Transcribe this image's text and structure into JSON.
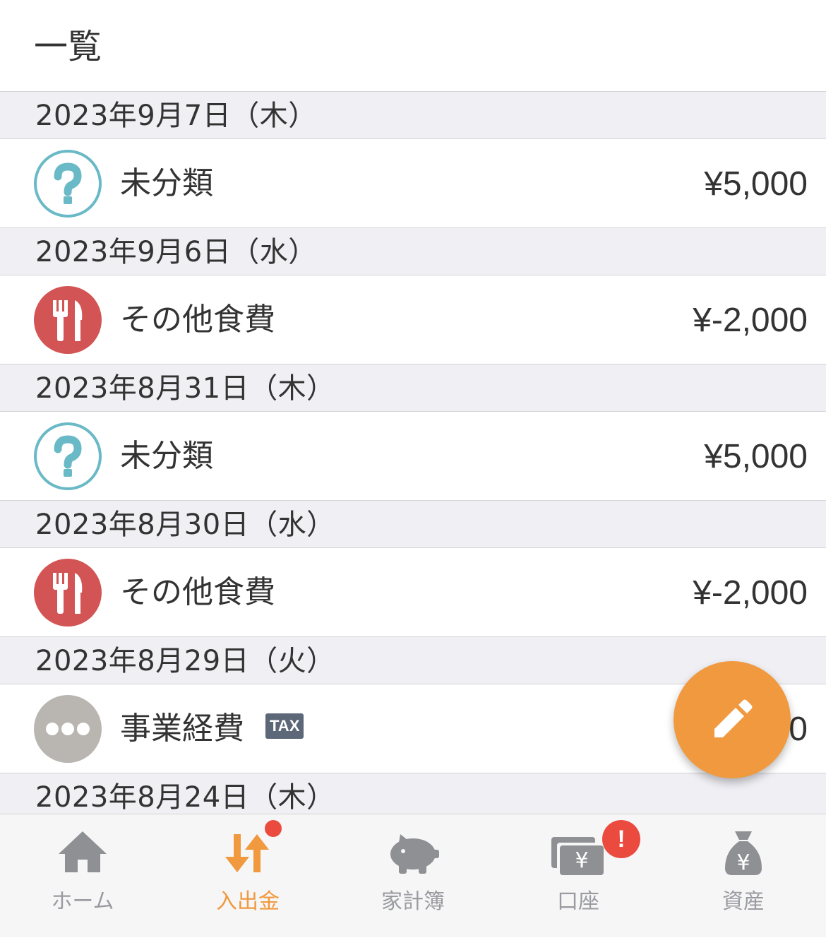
{
  "header": {
    "title": "一覧"
  },
  "entries": [
    {
      "date": "2023年9月7日（木）",
      "category": "未分類",
      "icon": "question-icon",
      "amount": "¥5,000"
    },
    {
      "date": "2023年9月6日（水）",
      "category": "その他食費",
      "icon": "fork-knife-icon",
      "amount": "¥-2,000"
    },
    {
      "date": "2023年8月31日（木）",
      "category": "未分類",
      "icon": "question-icon",
      "amount": "¥5,000"
    },
    {
      "date": "2023年8月30日（水）",
      "category": "その他食費",
      "icon": "fork-knife-icon",
      "amount": "¥-2,000"
    },
    {
      "date": "2023年8月29日（火）",
      "category": "事業経費",
      "icon": "more-dots-icon",
      "badge": "TAX",
      "amount": "0"
    },
    {
      "date": "2023年8月24日（木）"
    }
  ],
  "fab": {
    "icon": "pencil-icon",
    "color": "#f0993e"
  },
  "tabbar": {
    "tabs": [
      {
        "label": "ホーム",
        "icon": "home-icon"
      },
      {
        "label": "入出金",
        "icon": "transfer-arrows-icon",
        "active": true
      },
      {
        "label": "家計簿",
        "icon": "piggy-bank-icon"
      },
      {
        "label": "口座",
        "icon": "wallet-yen-icon",
        "alert": "!"
      },
      {
        "label": "資産",
        "icon": "money-bag-yen-icon"
      }
    ]
  },
  "colors": {
    "accent": "#f0993e",
    "food": "#d35454",
    "question": "#6ab9c6",
    "badge": "#eb4b3f"
  }
}
